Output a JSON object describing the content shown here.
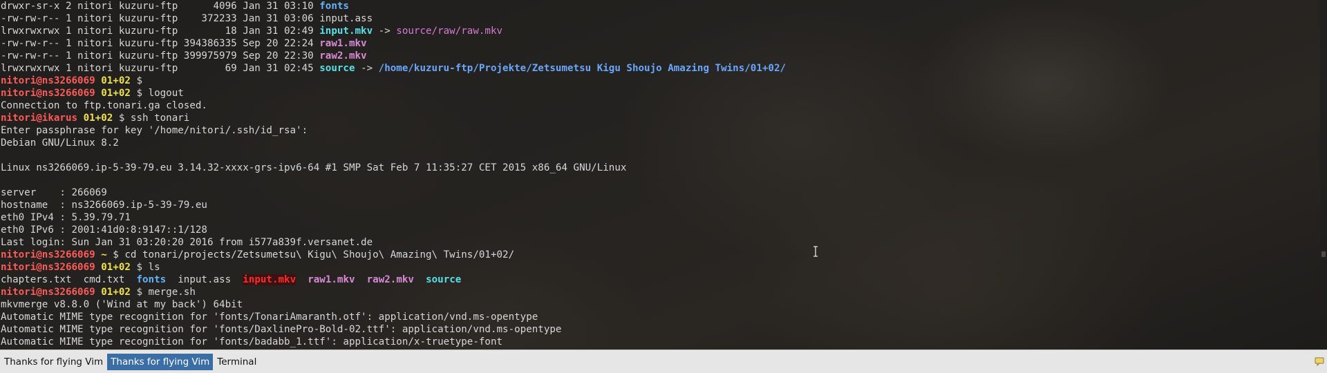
{
  "terminal": {
    "lines": [
      [
        {
          "t": "drwxr-sr-x 2 nitori kuzuru-ftp      4096 Jan 31 03:10 ",
          "c": "plain"
        },
        {
          "t": "fonts",
          "c": "dir"
        }
      ],
      [
        {
          "t": "-rw-rw-r-- 1 nitori kuzuru-ftp    372233 Jan 31 03:06 input.ass",
          "c": "plain"
        }
      ],
      [
        {
          "t": "lrwxrwxrwx 1 nitori kuzuru-ftp        18 Jan 31 02:49 ",
          "c": "plain"
        },
        {
          "t": "input.mkv",
          "c": "link"
        },
        {
          "t": " -> ",
          "c": "plain"
        },
        {
          "t": "source/raw/raw.mkv",
          "c": "target"
        }
      ],
      [
        {
          "t": "-rw-rw-r-- 1 nitori kuzuru-ftp 394386335 Sep 20 22:24 ",
          "c": "plain"
        },
        {
          "t": "raw1.mkv",
          "c": "video"
        }
      ],
      [
        {
          "t": "-rw-rw-r-- 1 nitori kuzuru-ftp 399975979 Sep 20 22:30 ",
          "c": "plain"
        },
        {
          "t": "raw2.mkv",
          "c": "video"
        }
      ],
      [
        {
          "t": "lrwxrwxrwx 1 nitori kuzuru-ftp        69 Jan 31 02:45 ",
          "c": "plain"
        },
        {
          "t": "source",
          "c": "link"
        },
        {
          "t": " -> ",
          "c": "plain"
        },
        {
          "t": "/home/kuzuru-ftp/Projekte/Zetsumetsu Kigu Shoujo Amazing Twins/01+02/",
          "c": "target-dir"
        }
      ],
      [
        {
          "t": "nitori@ns3266069",
          "c": "prompt-user"
        },
        {
          "t": " ",
          "c": "plain"
        },
        {
          "t": "01+02",
          "c": "prompt-path"
        },
        {
          "t": " $",
          "c": "plain"
        }
      ],
      [
        {
          "t": "nitori@ns3266069",
          "c": "prompt-user"
        },
        {
          "t": " ",
          "c": "plain"
        },
        {
          "t": "01+02",
          "c": "prompt-path"
        },
        {
          "t": " $ logout",
          "c": "plain"
        }
      ],
      [
        {
          "t": "Connection to ftp.tonari.ga closed.",
          "c": "plain"
        }
      ],
      [
        {
          "t": "nitori@ikarus",
          "c": "prompt-user"
        },
        {
          "t": " ",
          "c": "plain"
        },
        {
          "t": "01+02",
          "c": "prompt-path"
        },
        {
          "t": " $ ssh tonari",
          "c": "plain"
        }
      ],
      [
        {
          "t": "Enter passphrase for key '/home/nitori/.ssh/id_rsa':",
          "c": "plain"
        }
      ],
      [
        {
          "t": "Debian GNU/Linux 8.2",
          "c": "plain"
        }
      ],
      [
        {
          "t": "",
          "c": "plain"
        }
      ],
      [
        {
          "t": "Linux ns3266069.ip-5-39-79.eu 3.14.32-xxxx-grs-ipv6-64 #1 SMP Sat Feb 7 11:35:27 CET 2015 x86_64 GNU/Linux",
          "c": "plain"
        }
      ],
      [
        {
          "t": "",
          "c": "plain"
        }
      ],
      [
        {
          "t": "server    : 266069",
          "c": "plain"
        }
      ],
      [
        {
          "t": "hostname  : ns3266069.ip-5-39-79.eu",
          "c": "plain"
        }
      ],
      [
        {
          "t": "eth0 IPv4 : 5.39.79.71",
          "c": "plain"
        }
      ],
      [
        {
          "t": "eth0 IPv6 : 2001:41d0:8:9147::1/128",
          "c": "plain"
        }
      ],
      [
        {
          "t": "Last login: Sun Jan 31 03:20:20 2016 from i577a839f.versanet.de",
          "c": "plain"
        }
      ],
      [
        {
          "t": "nitori@ns3266069",
          "c": "prompt-user"
        },
        {
          "t": " ",
          "c": "plain"
        },
        {
          "t": "~",
          "c": "prompt-path"
        },
        {
          "t": " $ cd tonari/projects/Zetsumetsu\\ Kigu\\ Shoujo\\ Amazing\\ Twins/01+02/",
          "c": "plain"
        }
      ],
      [
        {
          "t": "nitori@ns3266069",
          "c": "prompt-user"
        },
        {
          "t": " ",
          "c": "plain"
        },
        {
          "t": "01+02",
          "c": "prompt-path"
        },
        {
          "t": " $ ls",
          "c": "plain"
        }
      ],
      [
        {
          "t": "chapters.txt  cmd.txt  ",
          "c": "plain"
        },
        {
          "t": "fonts",
          "c": "dir"
        },
        {
          "t": "  input.ass  ",
          "c": "plain"
        },
        {
          "t": "input.mkv",
          "c": "broken"
        },
        {
          "t": "  ",
          "c": "plain"
        },
        {
          "t": "raw1.mkv",
          "c": "video"
        },
        {
          "t": "  ",
          "c": "plain"
        },
        {
          "t": "raw2.mkv",
          "c": "video"
        },
        {
          "t": "  ",
          "c": "plain"
        },
        {
          "t": "source",
          "c": "link"
        }
      ],
      [
        {
          "t": "nitori@ns3266069",
          "c": "prompt-user"
        },
        {
          "t": " ",
          "c": "plain"
        },
        {
          "t": "01+02",
          "c": "prompt-path"
        },
        {
          "t": " $ merge.sh",
          "c": "plain"
        }
      ],
      [
        {
          "t": "mkvmerge v8.8.0 ('Wind at my back') 64bit",
          "c": "plain"
        }
      ],
      [
        {
          "t": "Automatic MIME type recognition for 'fonts/TonariAmaranth.otf': application/vnd.ms-opentype",
          "c": "plain"
        }
      ],
      [
        {
          "t": "Automatic MIME type recognition for 'fonts/DaxlinePro-Bold-02.ttf': application/vnd.ms-opentype",
          "c": "plain"
        }
      ],
      [
        {
          "t": "Automatic MIME type recognition for 'fonts/badabb_1.ttf': application/x-truetype-font",
          "c": "plain"
        }
      ]
    ]
  },
  "taskbar": {
    "items": [
      {
        "label": "Thanks for flying Vim",
        "active": false
      },
      {
        "label": "Thanks for flying Vim",
        "active": true
      },
      {
        "label": "Terminal",
        "active": false
      }
    ],
    "tray_icon": "message-icon"
  },
  "colors": {
    "prompt_user": "#ff5a5a",
    "prompt_path": "#f0e050",
    "directory": "#63b3ff",
    "symlink": "#58e0e8",
    "video_file": "#d98ad6",
    "broken_link": "#ff2b2b",
    "taskbar_active": "#3b6ea5",
    "taskbar_bg": "#e6e6e6"
  }
}
